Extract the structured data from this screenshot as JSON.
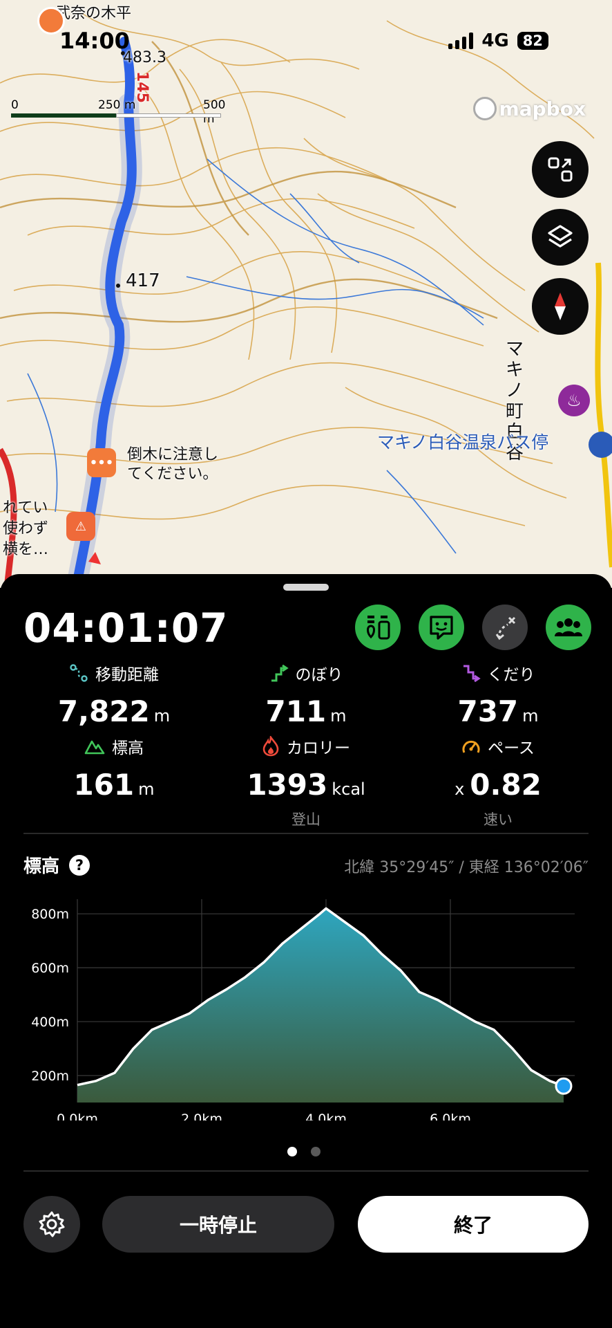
{
  "status_bar": {
    "time": "14:00",
    "network": "4G",
    "battery": "82"
  },
  "map": {
    "labels": {
      "place_top": "武奈の木平",
      "spot_483": "483.3",
      "route_no": "145",
      "spot_417": "417",
      "warning_note": "倒木に注意し\nてください。",
      "left_note": "れてい\n使わず\n横を…",
      "town_vertical": "マキノ町白谷",
      "bus_stop": "マキノ白谷温泉バス停"
    },
    "scale": {
      "zero": "0",
      "mid": "250 m",
      "max": "500 m"
    },
    "attribution": "mapbox",
    "buttons": [
      "expand-icon",
      "layers-icon",
      "compass-icon"
    ]
  },
  "activity": {
    "elapsed": "04:01:07",
    "top_buttons": [
      "route-info-icon",
      "chat-icon",
      "route-edit-icon",
      "group-icon"
    ],
    "stats": [
      {
        "label": "移動距離",
        "value": "7,822",
        "unit": "m",
        "icon": "distance-icon",
        "icon_color": "#5bc4c4"
      },
      {
        "label": "のぼり",
        "value": "711",
        "unit": "m",
        "icon": "ascent-icon",
        "icon_color": "#41c65a"
      },
      {
        "label": "くだり",
        "value": "737",
        "unit": "m",
        "icon": "descent-icon",
        "icon_color": "#b25ae0"
      },
      {
        "label": "標高",
        "value": "161",
        "unit": "m",
        "icon": "mountain-icon",
        "icon_color": "#41c65a"
      },
      {
        "label": "カロリー",
        "value": "1393",
        "unit": "kcal",
        "sub": "登山",
        "icon": "flame-icon",
        "icon_color": "#ee4a3a"
      },
      {
        "label": "ペース",
        "prefix": "x",
        "value": "0.82",
        "unit": "",
        "sub": "速い",
        "icon": "speedometer-icon",
        "icon_color": "#f0a020"
      }
    ]
  },
  "elevation": {
    "title": "標高",
    "coords": "北緯 35°29′45″ / 東経 136°02′06″"
  },
  "chart_data": {
    "type": "area",
    "title": "",
    "xlabel": "",
    "ylabel": "",
    "xlim": [
      0,
      8
    ],
    "ylim": [
      100,
      880
    ],
    "x_ticks": [
      "0.0km",
      "2.0km",
      "4.0km",
      "6.0km"
    ],
    "y_ticks": [
      "200m",
      "400m",
      "600m",
      "800m"
    ],
    "x": [
      0,
      0.3,
      0.6,
      0.9,
      1.2,
      1.5,
      1.8,
      2.1,
      2.4,
      2.7,
      3.0,
      3.3,
      3.6,
      3.9,
      4.0,
      4.3,
      4.6,
      4.9,
      5.2,
      5.5,
      5.8,
      6.1,
      6.4,
      6.7,
      7.0,
      7.3,
      7.6,
      7.822
    ],
    "values": [
      165,
      180,
      210,
      300,
      370,
      400,
      430,
      480,
      520,
      565,
      620,
      690,
      745,
      800,
      820,
      770,
      720,
      650,
      590,
      510,
      480,
      440,
      400,
      370,
      300,
      220,
      180,
      161
    ],
    "grid": true,
    "colors": {
      "top": "#2ea6bf",
      "bottom": "#3b5a3c",
      "line": "#ffffff",
      "marker": "#1f9cf0"
    }
  },
  "pager": {
    "pages": 2,
    "active": 0
  },
  "controls": {
    "settings_icon": "gear-icon",
    "pause_label": "一時停止",
    "finish_label": "終了"
  }
}
